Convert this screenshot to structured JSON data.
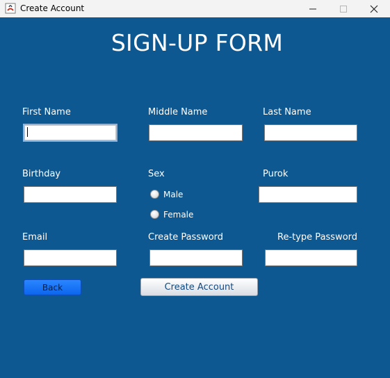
{
  "window": {
    "title": "Create Account",
    "icons": {
      "app": "java-app-icon",
      "minimize": "minimize-icon",
      "maximize": "maximize-icon",
      "close": "close-icon"
    }
  },
  "form": {
    "heading": "SIGN-UP FORM",
    "fields": {
      "first_name": {
        "label": "First Name",
        "value": ""
      },
      "middle_name": {
        "label": "Middle Name",
        "value": ""
      },
      "last_name": {
        "label": "Last Name",
        "value": ""
      },
      "birthday": {
        "label": "Birthday",
        "value": ""
      },
      "purok": {
        "label": "Purok",
        "value": ""
      },
      "email": {
        "label": "Email",
        "value": ""
      },
      "create_password": {
        "label": "Create Password",
        "value": ""
      },
      "retype_password": {
        "label": "Re-type Password",
        "value": ""
      }
    },
    "sex": {
      "label": "Sex",
      "options": [
        "Male",
        "Female"
      ],
      "selected": null
    },
    "buttons": {
      "back": "Back",
      "create": "Create Account"
    }
  },
  "colors": {
    "background": "#0e5891",
    "titlebar": "#f3f3f3",
    "back_button": "#1a78fb"
  }
}
